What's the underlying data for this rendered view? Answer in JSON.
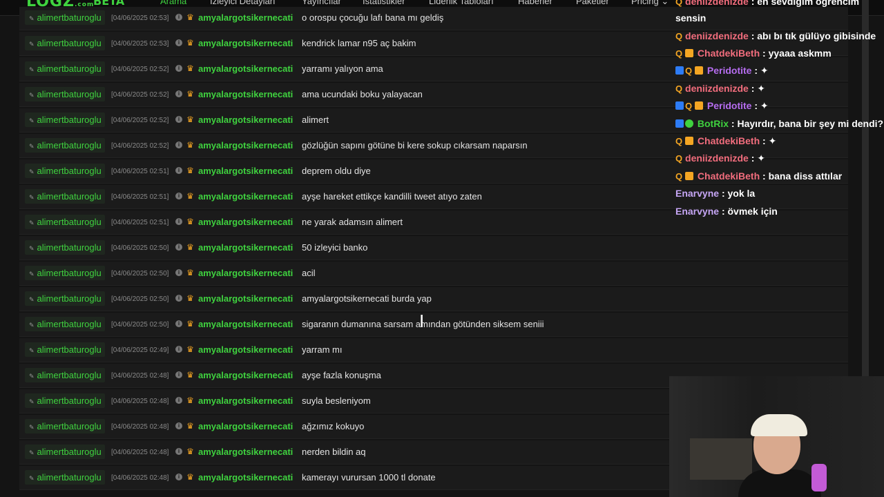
{
  "nav": {
    "logo": "LOGZ",
    "logo_suffix": ".com",
    "beta": "BETA",
    "items": [
      "Arama",
      "İzleyici Detayları",
      "Yayıncılar",
      "İstatistikler",
      "Liderlik Tabloları",
      "Haberler",
      "Paketler",
      "Pricing"
    ]
  },
  "log": {
    "user": "alimertbaturoglu",
    "target": "amyalargotsikernecati",
    "rows": [
      {
        "ts": "[04/06/2025 02:53]",
        "msg": "o orospu çocuğu lafı bana mı geldiş"
      },
      {
        "ts": "[04/06/2025 02:53]",
        "msg": "kendrick lamar n95 aç bakim"
      },
      {
        "ts": "[04/06/2025 02:52]",
        "msg": "yarramı yalıyon ama"
      },
      {
        "ts": "[04/06/2025 02:52]",
        "msg": "ama ucundaki boku yalayacan"
      },
      {
        "ts": "[04/06/2025 02:52]",
        "msg": "alimert"
      },
      {
        "ts": "[04/06/2025 02:52]",
        "msg": "gözlüğün sapını götüne bi kere sokup cıkarsam naparsın"
      },
      {
        "ts": "[04/06/2025 02:51]",
        "msg": "deprem oldu diye"
      },
      {
        "ts": "[04/06/2025 02:51]",
        "msg": "ayşe hareket ettikçe kandilli tweet atıyo zaten"
      },
      {
        "ts": "[04/06/2025 02:51]",
        "msg": "ne yarak adamsın alimert"
      },
      {
        "ts": "[04/06/2025 02:50]",
        "msg": "50 izleyici banko"
      },
      {
        "ts": "[04/06/2025 02:50]",
        "msg": "acil"
      },
      {
        "ts": "[04/06/2025 02:50]",
        "msg": "amyalargotsikernecati burda yap"
      },
      {
        "ts": "[04/06/2025 02:50]",
        "msg": "sigaranın dumanına sarsam amından götünden siksem seniii"
      },
      {
        "ts": "[04/06/2025 02:49]",
        "msg": "yarram mı"
      },
      {
        "ts": "[04/06/2025 02:48]",
        "msg": "ayşe fazla konuşma"
      },
      {
        "ts": "[04/06/2025 02:48]",
        "msg": "suyla besleniyom"
      },
      {
        "ts": "[04/06/2025 02:48]",
        "msg": "ağzımız kokuyo"
      },
      {
        "ts": "[04/06/2025 02:48]",
        "msg": "nerden bildin aq"
      },
      {
        "ts": "[04/06/2025 02:48]",
        "msg": "kamerayı vurursan 1000 tl donate"
      }
    ]
  },
  "chat": [
    {
      "name": "deniizdenizde",
      "color": "#f26d7d",
      "badges": [
        "q"
      ],
      "text": ": en sevdiğim öğrencim"
    },
    {
      "name": "",
      "color": "#ffffff",
      "badges": [],
      "text": "sensin"
    },
    {
      "name": "deniizdenizde",
      "color": "#f26d7d",
      "badges": [
        "q"
      ],
      "text": ": abı bı tık gülüyo gibisinde"
    },
    {
      "name": "ChatdekiBeth",
      "color": "#f26d7d",
      "badges": [
        "q",
        "s"
      ],
      "text": ": yyaaa askmm"
    },
    {
      "name": "Peridotite",
      "color": "#b66df0",
      "badges": [
        "p",
        "q",
        "s"
      ],
      "text": ": ✦"
    },
    {
      "name": "deniizdenizde",
      "color": "#f26d7d",
      "badges": [
        "q"
      ],
      "text": ": ✦"
    },
    {
      "name": "Peridotite",
      "color": "#b66df0",
      "badges": [
        "p",
        "q",
        "s"
      ],
      "text": ": ✦"
    },
    {
      "name": "BotRix",
      "color": "#3fd23f",
      "badges": [
        "p",
        "v"
      ],
      "text": ": Hayırdır, bana bir şey mi dendi?"
    },
    {
      "name": "ChatdekiBeth",
      "color": "#f26d7d",
      "badges": [
        "q",
        "s"
      ],
      "text": ": ✦"
    },
    {
      "name": "deniizdenizde",
      "color": "#f26d7d",
      "badges": [
        "q"
      ],
      "text": ": ✦"
    },
    {
      "name": "ChatdekiBeth",
      "color": "#f26d7d",
      "badges": [
        "q",
        "s"
      ],
      "text": ": bana diss attılar"
    },
    {
      "name": "Enarvyne",
      "color": "#c6a6f5",
      "badges": [],
      "text": ": yok la"
    },
    {
      "name": "Enarvyne",
      "color": "#c6a6f5",
      "badges": [],
      "text": ": övmek için"
    }
  ]
}
